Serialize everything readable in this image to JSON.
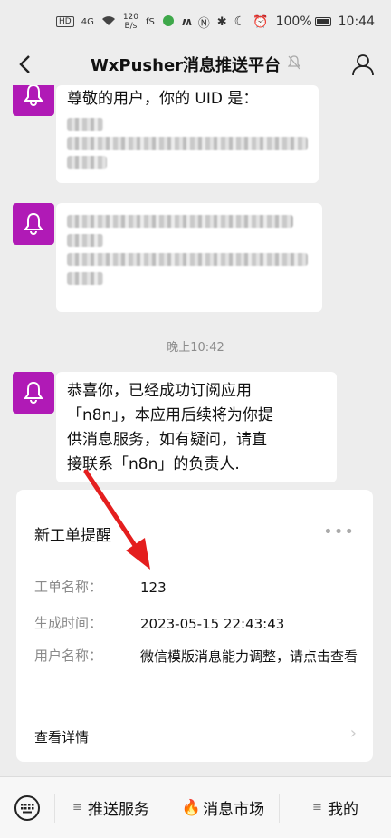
{
  "status_bar": {
    "network_badge": "HD",
    "signal_label": "4G",
    "speed_value": "120",
    "speed_unit": "B/s",
    "extra_indicator": "fS",
    "battery": "100%",
    "time": "10:44"
  },
  "header": {
    "title": "WxPusher消息推送平台"
  },
  "messages": [
    {
      "line1": "尊敬的用户，你的 UID 是："
    },
    {
      "blurred": true
    },
    {
      "line1": "恭喜你，已经成功订阅应用",
      "line2": "「n8n」，本应用后续将为你提",
      "line3": "供消息服务，如有疑问，请直",
      "line4": "接联系「n8n」的负责人."
    }
  ],
  "timestamp": "晚上10:42",
  "card": {
    "title": "新工单提醒",
    "fields": [
      {
        "label": "工单名称：",
        "value": "123"
      },
      {
        "label": "生成时间：",
        "value": "2023-05-15 22:43:43"
      },
      {
        "label": "用户名称：",
        "value": "微信模版消息能力调整，请点击查看"
      }
    ],
    "link_label": "查看详情"
  },
  "bottom_menu": {
    "items": [
      {
        "label": "推送服务"
      },
      {
        "label": "消息市场"
      },
      {
        "label": "我的"
      }
    ]
  },
  "colors": {
    "avatar_bg": "#b01ab6",
    "annotation_arrow": "#e41e1e",
    "background": "#ededed"
  }
}
